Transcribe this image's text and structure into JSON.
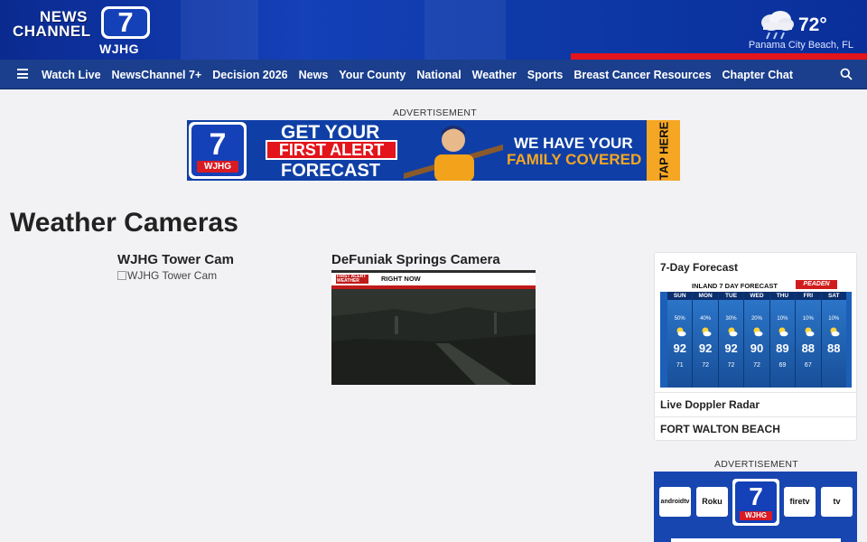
{
  "header": {
    "logo": {
      "line1": "NEWS",
      "line2": "CHANNEL",
      "number": "7",
      "callsign": "WJHG"
    },
    "weather": {
      "temperature": "72°",
      "location": "Panama City Beach, FL",
      "icon": "cloud-rain-icon"
    }
  },
  "nav": {
    "items": [
      "Watch Live",
      "NewsChannel 7+",
      "Decision 2026",
      "News",
      "Your County",
      "National",
      "Weather",
      "Sports",
      "Breast Cancer Resources",
      "Chapter Chat"
    ]
  },
  "top_ad": {
    "label": "ADVERTISEMENT",
    "logo_number": "7",
    "logo_callsign": "WJHG",
    "line1": "GET YOUR",
    "line2": "FIRST ALERT",
    "line3": "FORECAST",
    "right1": "WE HAVE YOUR",
    "right2": "FAMILY COVERED",
    "cta": "TAP HERE"
  },
  "page": {
    "title": "Weather Cameras"
  },
  "cameras": [
    {
      "title": "WJHG Tower Cam",
      "alt": "WJHG Tower Cam"
    },
    {
      "title": "DeFuniak Springs Camera",
      "tag": "FIRST ALERT WEATHER",
      "overlay": "RIGHT NOW"
    }
  ],
  "sidebar": {
    "forecast_title": "7-Day Forecast",
    "forecast_graphic": {
      "heading": "INLAND 7 DAY FORECAST",
      "sponsor": "PEADEN",
      "days": [
        {
          "day": "SUN",
          "pct": "50%",
          "hi": "92",
          "lo": "71"
        },
        {
          "day": "MON",
          "pct": "40%",
          "hi": "92",
          "lo": "72"
        },
        {
          "day": "TUE",
          "pct": "30%",
          "hi": "92",
          "lo": "72"
        },
        {
          "day": "WED",
          "pct": "20%",
          "hi": "90",
          "lo": "72"
        },
        {
          "day": "THU",
          "pct": "10%",
          "hi": "89",
          "lo": "69"
        },
        {
          "day": "FRI",
          "pct": "10%",
          "hi": "88",
          "lo": "67"
        },
        {
          "day": "SAT",
          "pct": "10%",
          "hi": "88",
          "lo": ""
        }
      ]
    },
    "links": [
      "Live Doppler Radar",
      "FORT WALTON BEACH"
    ],
    "ad_label": "ADVERTISEMENT",
    "apps": [
      "androidtv",
      "Roku",
      "firetv",
      "tv"
    ],
    "app_logo_number": "7",
    "app_logo_callsign": "WJHG"
  },
  "colors": {
    "brand_blue": "#1440b8",
    "nav_blue": "#1b3f8d",
    "alert_red": "#e3141b",
    "accent_orange": "#f5a623"
  }
}
